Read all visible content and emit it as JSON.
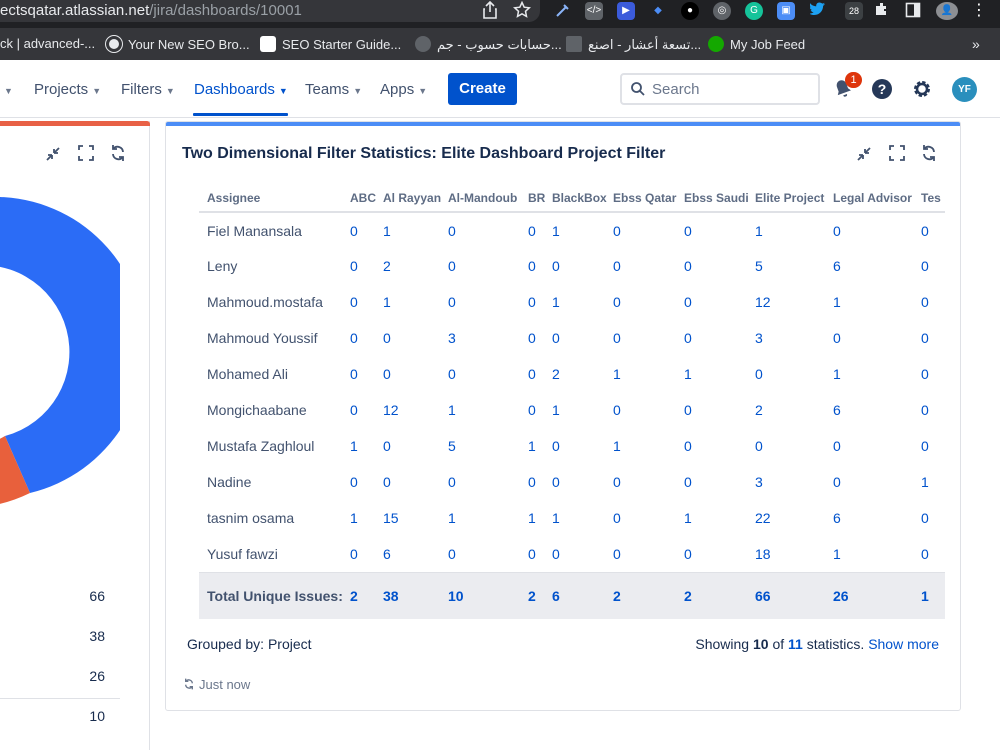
{
  "browser": {
    "url_domain": "ectsqatar.atlassian.net",
    "url_path": "/jira/dashboards/10001",
    "extension_badge": "28",
    "bookmarks": [
      {
        "label": "ck | advanced-...",
        "color": "#e8eaed"
      },
      {
        "label": "Your New SEO Bro...",
        "color": "#3858e9"
      },
      {
        "label": "SEO Starter Guide...",
        "color": "#34a853"
      },
      {
        "label": "حسابات حسوب - جم...",
        "color": "#5f6368"
      },
      {
        "label": "تسعة أعشار - اصنع...",
        "color": "#5f6368"
      },
      {
        "label": "My Job Feed",
        "color": "#14a800"
      }
    ]
  },
  "nav": {
    "items": [
      {
        "label": "Projects",
        "active": false
      },
      {
        "label": "Filters",
        "active": false
      },
      {
        "label": "Dashboards",
        "active": true
      },
      {
        "label": "Teams",
        "active": false
      },
      {
        "label": "Apps",
        "active": false
      }
    ],
    "create_label": "Create",
    "search_placeholder": "Search",
    "notification_count": "1",
    "avatar_initials": "YF"
  },
  "left_gadget": {
    "values": [
      "66",
      "38",
      "26",
      "10"
    ],
    "donut_colors": [
      "#2b6cf6",
      "#e8603c"
    ]
  },
  "gadget": {
    "title": "Two Dimensional Filter Statistics: Elite Dashboard Project Filter",
    "columns": [
      "Assignee",
      "ABC",
      "Al Rayyan",
      "Al-Mandoub",
      "BR",
      "BlackBox",
      "Ebss Qatar",
      "Ebss Saudi",
      "Elite Project",
      "Legal Advisor",
      "Tes"
    ],
    "rows": [
      {
        "name": "Fiel Manansala",
        "values": [
          "0",
          "1",
          "0",
          "0",
          "1",
          "0",
          "0",
          "1",
          "0",
          "0"
        ]
      },
      {
        "name": "Leny",
        "values": [
          "0",
          "2",
          "0",
          "0",
          "0",
          "0",
          "0",
          "5",
          "6",
          "0"
        ]
      },
      {
        "name": "Mahmoud.mostafa",
        "values": [
          "0",
          "1",
          "0",
          "0",
          "1",
          "0",
          "0",
          "12",
          "1",
          "0"
        ]
      },
      {
        "name": "Mahmoud Youssif",
        "values": [
          "0",
          "0",
          "3",
          "0",
          "0",
          "0",
          "0",
          "3",
          "0",
          "0"
        ]
      },
      {
        "name": "Mohamed Ali",
        "values": [
          "0",
          "0",
          "0",
          "0",
          "2",
          "1",
          "1",
          "0",
          "1",
          "0"
        ]
      },
      {
        "name": "Mongichaabane",
        "values": [
          "0",
          "12",
          "1",
          "0",
          "1",
          "0",
          "0",
          "2",
          "6",
          "0"
        ]
      },
      {
        "name": "Mustafa Zaghloul",
        "values": [
          "1",
          "0",
          "5",
          "1",
          "0",
          "1",
          "0",
          "0",
          "0",
          "0"
        ]
      },
      {
        "name": "Nadine",
        "values": [
          "0",
          "0",
          "0",
          "0",
          "0",
          "0",
          "0",
          "3",
          "0",
          "1"
        ]
      },
      {
        "name": "tasnim osama",
        "values": [
          "1",
          "15",
          "1",
          "1",
          "1",
          "0",
          "1",
          "22",
          "6",
          "0"
        ]
      },
      {
        "name": "Yusuf fawzi",
        "values": [
          "0",
          "6",
          "0",
          "0",
          "0",
          "0",
          "0",
          "18",
          "1",
          "0"
        ]
      }
    ],
    "total_label": "Total Unique Issues:",
    "totals": [
      "2",
      "38",
      "10",
      "2",
      "6",
      "2",
      "2",
      "66",
      "26",
      "1"
    ],
    "grouped_by": "Grouped by: Project",
    "showing_prefix": "Showing",
    "showing_count": "10",
    "showing_of": "of",
    "showing_total": "11",
    "showing_suffix": "statistics.",
    "show_more": "Show more",
    "updated": "Just now"
  }
}
